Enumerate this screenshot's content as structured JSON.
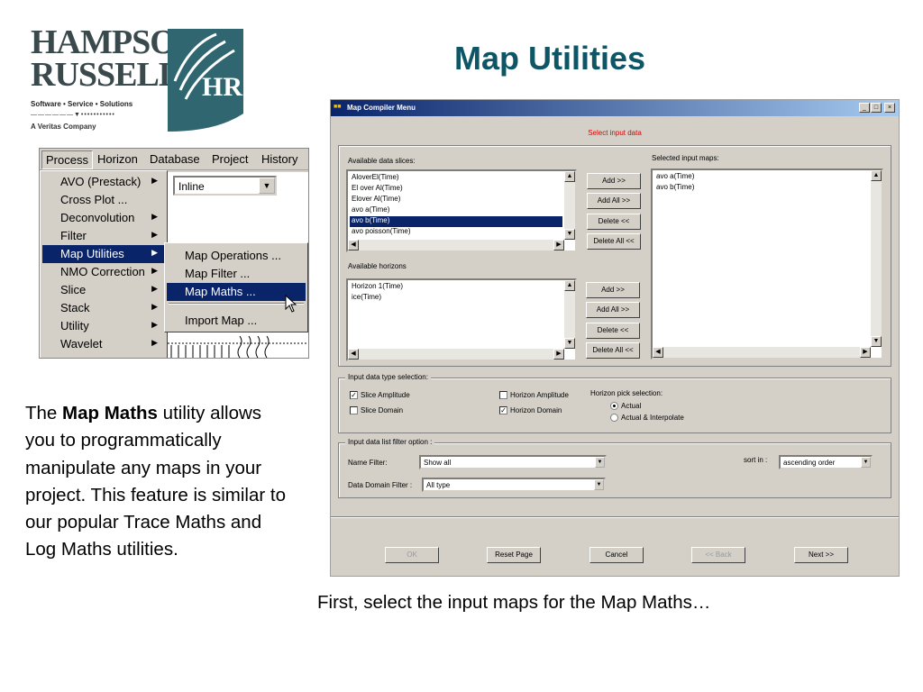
{
  "logo": {
    "line1": "HAMPSON",
    "line2": "RUSSELL",
    "tagline": "Software • Service • Solutions",
    "rule": "——————▼•••••••••••",
    "company": "A Veritas Company",
    "mark_letters": "HR"
  },
  "slide": {
    "title": "Map Utilities",
    "body_prefix": "The ",
    "body_bold": "Map Maths",
    "body_suffix": " utility allows you to programmatically manipulate any maps in your project.  This feature is similar to our popular Trace Maths and Log Maths utilities.",
    "caption": "First, select the input maps for the Map Maths…"
  },
  "menu_shot": {
    "menubar": [
      "Process",
      "Horizon",
      "Database",
      "Project",
      "History"
    ],
    "inline_value": "Inline",
    "process_items": [
      {
        "label": "AVO (Prestack)",
        "has_sub": true
      },
      {
        "label": "Cross Plot ...",
        "has_sub": false
      },
      {
        "label": "Deconvolution",
        "has_sub": true
      },
      {
        "label": "Filter",
        "has_sub": true
      },
      {
        "label": "Map Utilities",
        "has_sub": true
      },
      {
        "label": "NMO Correction",
        "has_sub": true
      },
      {
        "label": "Slice",
        "has_sub": true
      },
      {
        "label": "Stack",
        "has_sub": true
      },
      {
        "label": "Utility",
        "has_sub": true
      },
      {
        "label": "Wavelet",
        "has_sub": true
      }
    ],
    "selected_item": "Map Utilities",
    "submenu_items": [
      "Map Operations ...",
      "Map Filter ...",
      "Map Maths ...",
      "Import Map ..."
    ],
    "selected_sub": "Map Maths ..."
  },
  "dialog": {
    "title": "Map Compiler Menu",
    "win_buttons": [
      "_",
      "□",
      "×"
    ],
    "instruction": "Select input data",
    "available_slices_label": "Available data slices:",
    "available_slices": [
      "AloverEl(Time)",
      "El over Al(Time)",
      "Elover Al(Time)",
      "avo a(Time)",
      "avo b(Time)",
      "avo poisson(Time)"
    ],
    "selected_slice": "avo b(Time)",
    "selected_maps_label": "Selected input maps:",
    "selected_maps": [
      "avo a(Time)",
      "avo b(Time)"
    ],
    "available_horizons_label": "Available horizons",
    "available_horizons": [
      "Horizon 1(Time)",
      "ice(Time)"
    ],
    "btn_add": "Add >>",
    "btn_add_all": "Add All >>",
    "btn_delete": "Delete <<",
    "btn_delete_all": "Delete All <<",
    "type_group_label": "Input data type selection:",
    "chk_slice_amplitude": "Slice Amplitude",
    "chk_slice_domain": "Slice Domain",
    "chk_horizon_amplitude": "Horizon Amplitude",
    "chk_horizon_domain": "Horizon Domain",
    "checked": {
      "slice_amplitude": true,
      "slice_domain": false,
      "horizon_amplitude": false,
      "horizon_domain": true
    },
    "pick_label": "Horizon pick selection:",
    "radio_actual": "Actual",
    "radio_interp": "Actual & Interpolate",
    "filter_group_label": "Input data list filter option :",
    "name_filter_label": "Name Filter:",
    "name_filter_value": "Show all",
    "domain_filter_label": "Data Domain Filter :",
    "domain_filter_value": "All type",
    "sort_label": "sort in :",
    "sort_value": "ascending order",
    "btn_ok": "OK",
    "btn_reset": "Reset Page",
    "btn_cancel": "Cancel",
    "btn_back": "<< Back",
    "btn_next": "Next >>"
  },
  "colors": {
    "title": "#0e5666",
    "selection": "#0a246a",
    "instruction": "#e00000",
    "logo_teal": "#2f6670"
  }
}
